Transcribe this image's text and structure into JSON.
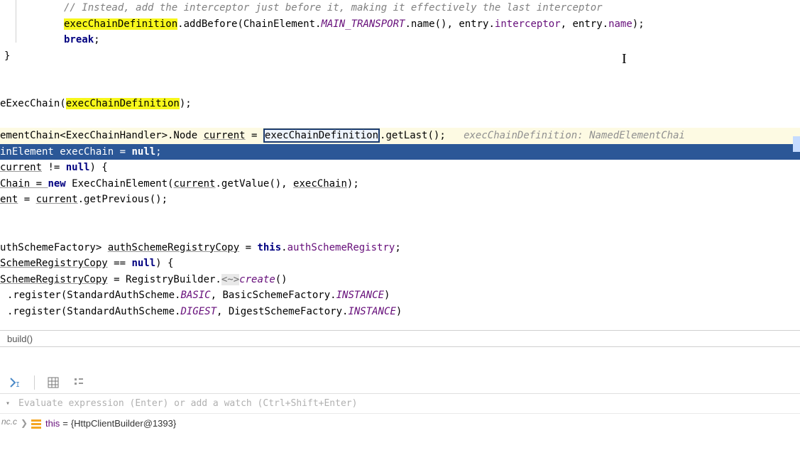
{
  "code": {
    "l1_comment": "// Instead, add the interceptor just before it, making it effectively the last interceptor",
    "l2_a": "execChainDefinition",
    "l2_b": ".addBefore(ChainElement.",
    "l2_c": "MAIN_TRANSPORT",
    "l2_d": ".name(), entry.",
    "l2_e": "interceptor",
    "l2_f": ", entry.",
    "l2_g": "name",
    "l2_h": ");",
    "l3_break": "break",
    "l3_semi": ";",
    "l4_brace": "}",
    "l8_a": "eExecChain(",
    "l8_b": "execChainDefinition",
    "l8_c": ");",
    "l10_a": "ementChain<ExecChainHandler>.Node ",
    "l10_b": "current",
    "l10_c": " = ",
    "l10_d": "execChainDefinition",
    "l10_e": ".getLast();",
    "l10_hint": "execChainDefinition: NamedElementChai",
    "l11_a": "inElement execChain = ",
    "l11_b": "null",
    "l11_c": ";",
    "l12_a": "current",
    "l12_b": " != ",
    "l12_c": "null",
    "l12_d": ") {",
    "l13_a": "Chain = ",
    "l13_b": "new",
    "l13_c": " ExecChainElement(",
    "l13_d": "current",
    "l13_e": ".getValue(), ",
    "l13_f": "execChain",
    "l13_g": ");",
    "l14_a": "ent",
    "l14_b": " = ",
    "l14_c": "current",
    "l14_d": ".getPrevious();",
    "l17_a": "uthSchemeFactory> ",
    "l17_b": "authSchemeRegistryCopy",
    "l17_c": " = ",
    "l17_d": "this",
    "l17_e": ".",
    "l17_f": "authSchemeRegistry",
    "l17_g": ";",
    "l18_a": "SchemeRegistryCopy",
    "l18_b": " == ",
    "l18_c": "null",
    "l18_d": ") {",
    "l19_a": "SchemeRegistryCopy",
    "l19_b": " = RegistryBuilder.",
    "l19_c": "<~>",
    "l19_d": "create",
    "l19_e": "()",
    "l20_a": ".register(StandardAuthScheme.",
    "l20_b": "BASIC",
    "l20_c": ", BasicSchemeFactory.",
    "l20_d": "INSTANCE",
    "l20_e": ")",
    "l21_a": ".register(StandardAuthScheme.",
    "l21_b": "DIGEST",
    "l21_c": ", DigestSchemeFactory.",
    "l21_d": "INSTANCE",
    "l21_e": ")"
  },
  "breadcrumb": {
    "method": "build()"
  },
  "watch": {
    "placeholder": "Evaluate expression (Enter) or add a watch (Ctrl+Shift+Enter)"
  },
  "vars": {
    "left_label": "nc.c",
    "this_name": "this",
    "this_eq": " = ",
    "this_val": "{HttpClientBuilder@1393}"
  }
}
